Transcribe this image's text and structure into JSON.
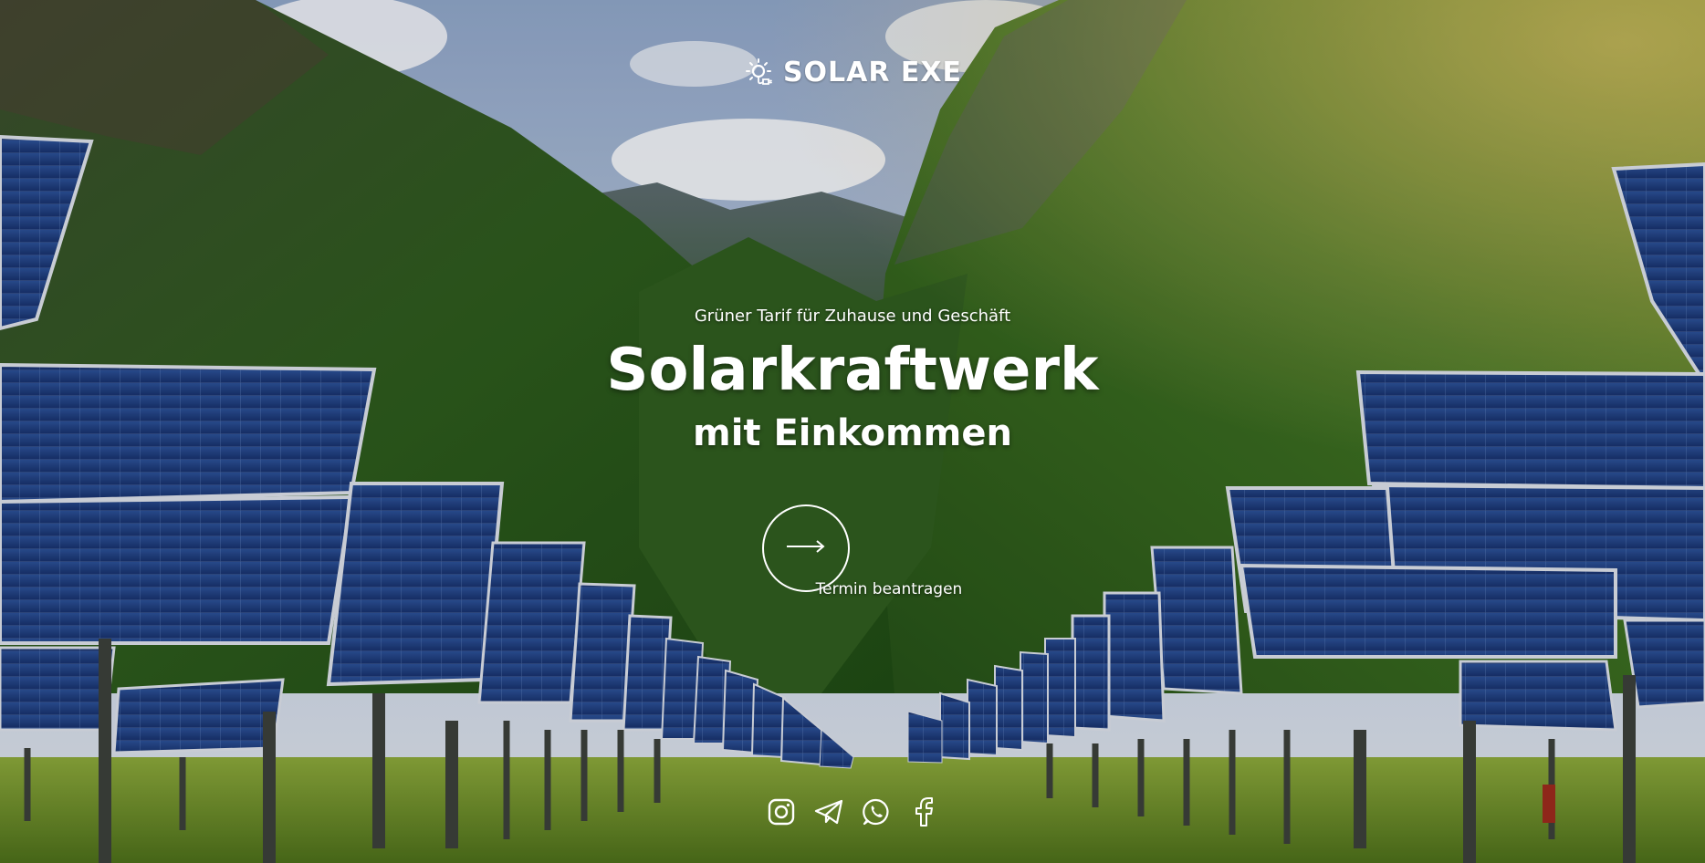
{
  "brand": {
    "logo_text": "SOLAR EXE",
    "icon": "sun-plug-icon"
  },
  "hero": {
    "tagline": "Grüner Tarif für Zuhause und Geschäft",
    "headline": "Solarkraftwerk",
    "subheadline": "mit Einkommen",
    "cta_label": "Termin beantragen",
    "cta_icon": "arrow-right-icon"
  },
  "social": [
    {
      "name": "instagram-icon"
    },
    {
      "name": "telegram-icon"
    },
    {
      "name": "whatsapp-icon"
    },
    {
      "name": "facebook-icon"
    }
  ],
  "colors": {
    "text": "#ffffff",
    "sky": "#a9bcd6",
    "mountain_green": "#2f5a1f",
    "panel_blue": "#1d3d7a",
    "grass": "#6e8f24"
  }
}
